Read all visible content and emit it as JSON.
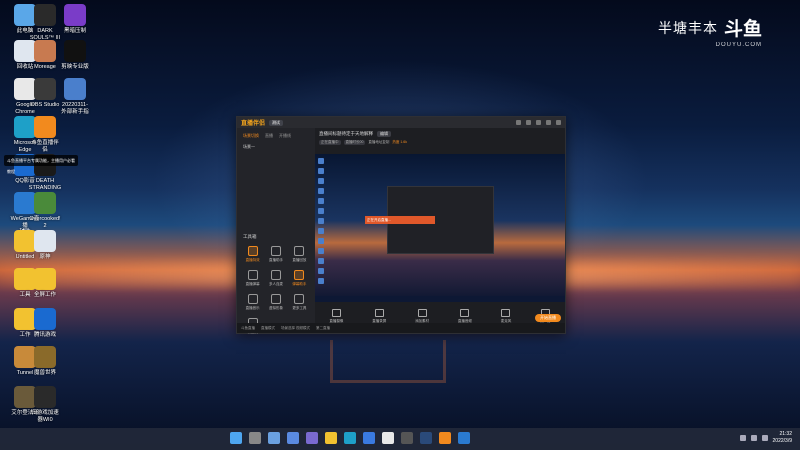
{
  "watermark": {
    "text": "半塘丰本",
    "logo": "斗鱼",
    "url": "DOUYU.COM"
  },
  "desktop_icons": [
    {
      "label": "此电脑",
      "color": "#5aa7e8"
    },
    {
      "label": "DARK\nSOULS™ III",
      "color": "#2a2a2a"
    },
    {
      "label": "黑暗压制",
      "color": "#7a3cc8"
    },
    {
      "label": "回收站",
      "color": "#dfe6ef"
    },
    {
      "label": "Moreage",
      "color": "#c87a50"
    },
    {
      "label": "剪映专业版",
      "color": "#111111"
    },
    {
      "label": "Google\nChrome",
      "color": "#e8e8e8"
    },
    {
      "label": "OBS Studio",
      "color": "#3a3a3a"
    },
    {
      "label": "20220311-\n外部新手指",
      "color": "#4a7fcc"
    },
    {
      "label": "Microsoft\nEdge",
      "color": "#1ea0c8"
    },
    {
      "label": "斗鱼直播伴\n侣",
      "color": "#f28a1e"
    },
    {
      "label": "QQ影音",
      "color": "#1a6ad0"
    },
    {
      "label": "DEATH\nSTRANDING",
      "color": "#1a1a1a"
    },
    {
      "label": "WeGame直播\n辅助",
      "color": "#2a7ad0"
    },
    {
      "label": "Overcooked!\n2",
      "color": "#4a8a3a"
    },
    {
      "label": "Untitled",
      "color": "#f2c230"
    },
    {
      "label": "原神",
      "color": "#dfe6ef"
    },
    {
      "label": "工具",
      "color": "#f2c230"
    },
    {
      "label": "全屏工作",
      "color": "#f2c230"
    },
    {
      "label": "工作",
      "color": "#f2c230"
    },
    {
      "label": "腾讯游戏",
      "color": "#1a6ad0"
    },
    {
      "label": "Tunnel",
      "color": "#c88a3a"
    },
    {
      "label": "魔兽世界",
      "color": "#8a6a2a"
    },
    {
      "label": "艾尔登法环",
      "color": "#6a5a3a"
    },
    {
      "label": "归游戏加速\n器WI0",
      "color": "#2a2a2a"
    }
  ],
  "app": {
    "name": "直播伴侣",
    "version": "测试",
    "left_tabs": [
      "场景切换",
      "直播",
      "开播线"
    ],
    "scene_label": "场景一",
    "tools_heading": "工具箱",
    "tools": [
      "直播特效",
      "直播助手",
      "直播回放",
      "直播弹幕",
      "多人连麦",
      "弹幕助手",
      "直播音乐",
      "虚拟形象",
      "更多工具",
      "新工具"
    ],
    "room_title": "直播间标题待定于天地解释",
    "room_badge": "编辑",
    "meta_tags": [
      "正在直播中",
      "直播时长00"
    ],
    "meta_text": "直播地址复制",
    "hot_value": "热度 1.6k",
    "toast_text": "正在开启直播...",
    "controls": [
      "直播摄像",
      "直播录屏",
      "添加素材",
      "直播音频",
      "麦克风",
      "扬声器"
    ],
    "start_button": "开始直播",
    "status": [
      "斗鱼直播",
      "直播模式",
      "场景选择  视频模式",
      "第二直播"
    ],
    "pill_text": "斗鱼直播平台专属功能，主播用户必看教程"
  },
  "taskbar": {
    "icons": [
      "start",
      "search",
      "task-view",
      "widgets",
      "chat",
      "explorer",
      "edge",
      "store",
      "chrome",
      "obs",
      "steam",
      "douyu",
      "vscode"
    ],
    "time": "21:32",
    "date": "2022/3/9"
  }
}
